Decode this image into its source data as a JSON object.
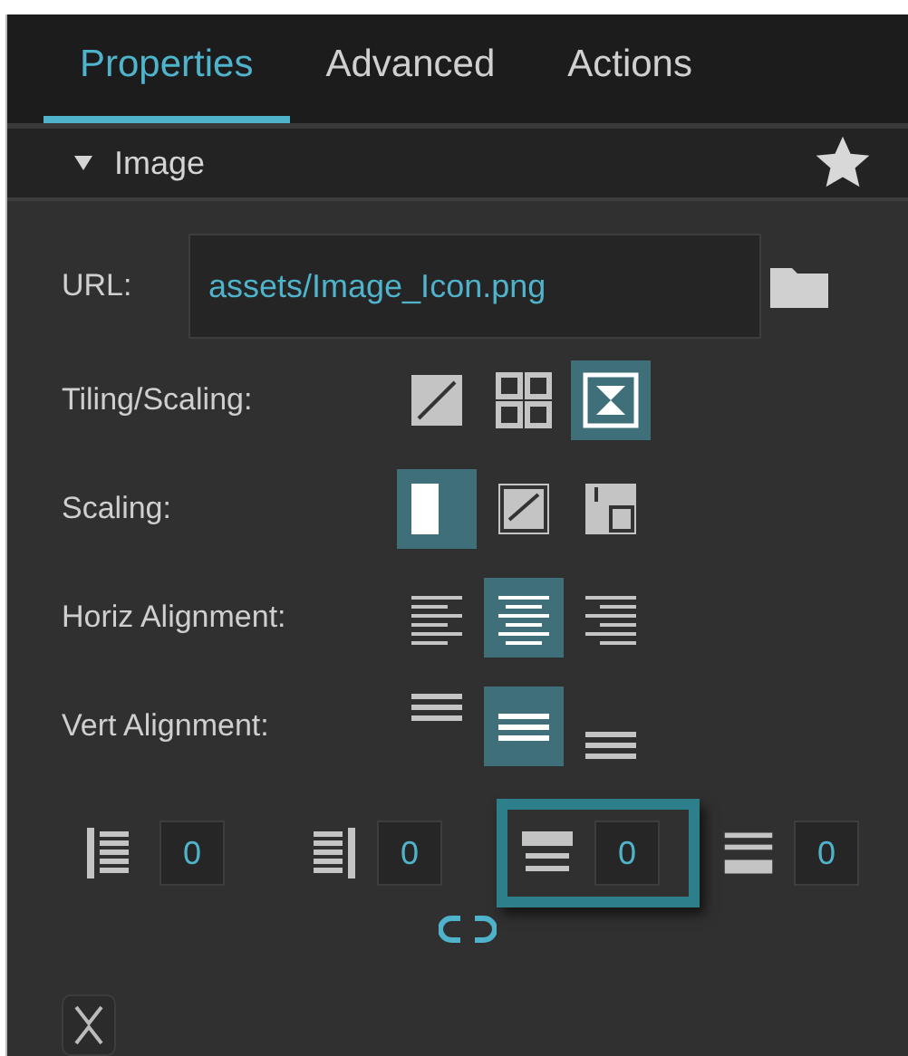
{
  "tabs": [
    {
      "label": "Properties",
      "selected": true
    },
    {
      "label": "Advanced",
      "selected": false
    },
    {
      "label": "Actions",
      "selected": false
    }
  ],
  "section": {
    "title": "Image",
    "expanded": true
  },
  "url": {
    "label": "URL:",
    "value": "assets/Image_Icon.png"
  },
  "option_rows": [
    {
      "label": "Tiling/Scaling:",
      "options": [
        {
          "kind": "stretch",
          "selected": false
        },
        {
          "kind": "tile",
          "selected": false
        },
        {
          "kind": "fit",
          "selected": true
        }
      ]
    },
    {
      "label": "Scaling:",
      "options": [
        {
          "kind": "fill",
          "selected": true
        },
        {
          "kind": "scale",
          "selected": false
        },
        {
          "kind": "corner",
          "selected": false
        }
      ]
    },
    {
      "label": "Horiz Alignment:",
      "options": [
        {
          "kind": "align-left",
          "selected": false
        },
        {
          "kind": "align-center",
          "selected": true
        },
        {
          "kind": "align-right",
          "selected": false
        }
      ]
    },
    {
      "label": "Vert Alignment:",
      "options": [
        {
          "kind": "align-top",
          "selected": false
        },
        {
          "kind": "align-middle",
          "selected": true
        },
        {
          "kind": "align-bottom",
          "selected": false
        }
      ]
    }
  ],
  "padding": [
    {
      "kind": "left",
      "value": "0",
      "selected": false
    },
    {
      "kind": "right",
      "value": "0",
      "selected": false
    },
    {
      "kind": "top",
      "value": "0",
      "selected": true
    },
    {
      "kind": "bottom",
      "value": "0",
      "selected": false
    }
  ]
}
